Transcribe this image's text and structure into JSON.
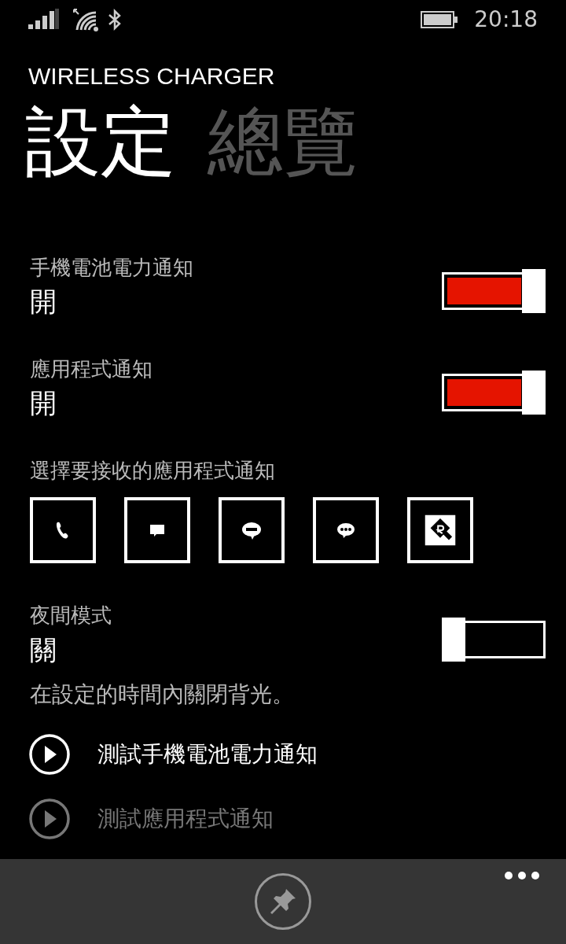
{
  "status_bar": {
    "time": "20:18"
  },
  "app_title": "WIRELESS CHARGER",
  "pivots": [
    {
      "label": "設定",
      "selected": true
    },
    {
      "label": "總覽",
      "selected": false
    }
  ],
  "settings": [
    {
      "kind": "toggle",
      "label": "手機電池電力通知",
      "value": "開",
      "on": true
    },
    {
      "kind": "toggle",
      "label": "應用程式通知",
      "value": "開",
      "on": true
    },
    {
      "kind": "apps",
      "label": "選擇要接收的應用程式通知"
    },
    {
      "kind": "toggle",
      "label": "夜間模式",
      "value": "關",
      "on": false,
      "description": "在設定的時間內關閉背光。"
    }
  ],
  "actions": [
    {
      "label": "測試手機電池電力通知"
    },
    {
      "label": "測試應用程式通知"
    }
  ]
}
